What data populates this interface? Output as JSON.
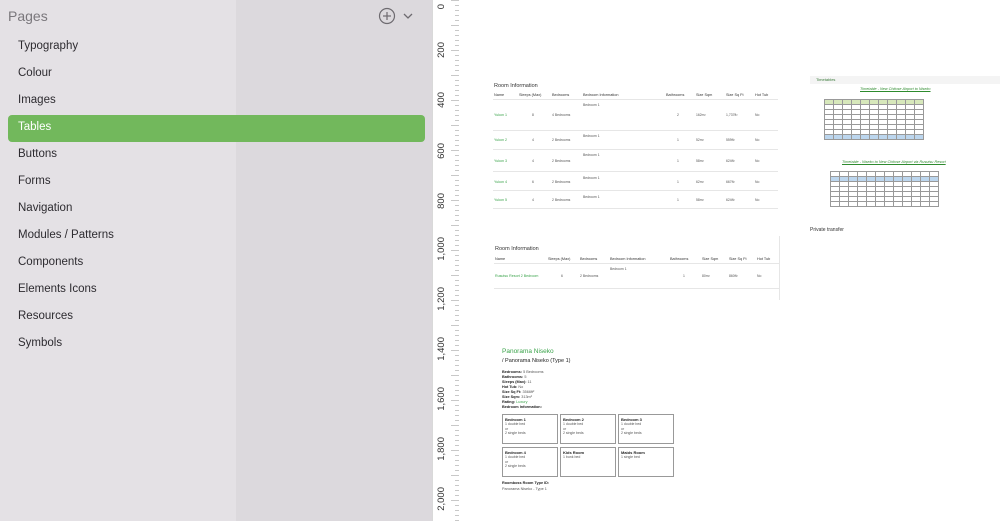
{
  "sidebar": {
    "title": "Pages",
    "add_icon": "plus-circle-icon",
    "menu_icon": "chevron-down-icon",
    "items": [
      {
        "label": "Typography"
      },
      {
        "label": "Colour"
      },
      {
        "label": "Images"
      },
      {
        "label": "Tables",
        "active": true
      },
      {
        "label": "Buttons"
      },
      {
        "label": "Forms"
      },
      {
        "label": "Navigation"
      },
      {
        "label": "Modules / Patterns"
      },
      {
        "label": "Components"
      },
      {
        "label": "Elements Icons"
      },
      {
        "label": "Resources"
      },
      {
        "label": "Symbols"
      }
    ]
  },
  "ruler": {
    "labels": [
      "0",
      "200",
      "400",
      "600",
      "800",
      "1,000",
      "1,200",
      "1,400",
      "1,600",
      "1,800",
      "2,000"
    ]
  },
  "canvas": {
    "room_table_1": {
      "title": "Room Information",
      "headers": [
        "Name",
        "Sleeps (Max)",
        "Bedrooms",
        "Bedroom Information",
        "Bathrooms",
        "Size Sqm",
        "Size Sq Ft",
        "Hot Tub"
      ],
      "rows": [
        {
          "name": "Yukon 1",
          "sleeps": "8",
          "bedrooms": "4 Bedrooms",
          "info": "Bedroom 1",
          "baths": "2",
          "sqm": "162m²",
          "sqft": "1,737ft²",
          "hottub": "No"
        },
        {
          "name": "Yukon 2",
          "sleeps": "4",
          "bedrooms": "2 Bedrooms",
          "info": "Bedroom 1",
          "baths": "1",
          "sqm": "52m²",
          "sqft": "559ft²",
          "hottub": "No"
        },
        {
          "name": "Yukon 3",
          "sleeps": "4",
          "bedrooms": "2 Bedrooms",
          "info": "Bedroom 1",
          "baths": "1",
          "sqm": "58m²",
          "sqft": "624ft²",
          "hottub": "No"
        },
        {
          "name": "Yukon 4",
          "sleeps": "6",
          "bedrooms": "2 Bedrooms",
          "info": "Bedroom 1",
          "baths": "1",
          "sqm": "62m²",
          "sqft": "667ft²",
          "hottub": "No"
        },
        {
          "name": "Yukon 5",
          "sleeps": "4",
          "bedrooms": "2 Bedrooms",
          "info": "Bedroom 1",
          "baths": "1",
          "sqm": "58m²",
          "sqft": "624ft²",
          "hottub": "No"
        }
      ]
    },
    "room_table_2": {
      "title": "Room Information",
      "headers": [
        "Name",
        "Sleeps (Max)",
        "Bedrooms",
        "Bedroom Information",
        "Bathrooms",
        "Size Sqm",
        "Size Sq Ft",
        "Hot Tub"
      ],
      "row": {
        "name": "Rusutsu Resort 2 Bedroom",
        "sleeps": "6",
        "bedrooms": "2 Bedrooms",
        "info": "Bedroom 1",
        "baths": "1",
        "sqm": "80m²",
        "sqft": "860ft²",
        "hottub": "No"
      }
    },
    "timetable": {
      "tab": "Timetables",
      "title1": "Timetable - New Chitose Airport to Niseko",
      "title2": "Timetable - Niseko to New Chitose Airport via Rusutsu Resort",
      "private": "Private transfer"
    },
    "property": {
      "title": "Panorama Niseko",
      "subtitle": "/ Panorama Niseko (Type 1)",
      "bedrooms_label": "Bedrooms:",
      "bedrooms_value": "5 Bedrooms",
      "bathrooms_label": "Bathrooms:",
      "bathrooms_value": "5",
      "sleeps_label": "Sleeps (Max):",
      "sleeps_value": "11",
      "hottub_label": "Hot Tub:",
      "hottub_value": "No",
      "sqft_label": "Size Sq Ft:",
      "sqft_value": "3566ft²",
      "sqm_label": "Size Sqm:",
      "sqm_value": "313m²",
      "rating_label": "Rating:",
      "rating_value": "Luxury",
      "bedinfo_label": "Bedroom Information:",
      "beds": [
        {
          "title": "Bedroom 1",
          "l1": "1 double bed",
          "l2": "or",
          "l3": "2 single beds"
        },
        {
          "title": "Bedroom 2",
          "l1": "1 double bed",
          "l2": "or",
          "l3": "2 single beds"
        },
        {
          "title": "Bedroom 3",
          "l1": "1 double bed",
          "l2": "or",
          "l3": "2 single beds"
        },
        {
          "title": "Bedroom 4",
          "l1": "1 double bed",
          "l2": "or",
          "l3": "2 single beds"
        },
        {
          "title": "Kids Room",
          "l1": "1 bunk bed",
          "l2": "",
          "l3": ""
        },
        {
          "title": "Maids Room",
          "l1": "1 single bed",
          "l2": "",
          "l3": ""
        }
      ],
      "roomboss_label": "Roomboss Room Type ID:",
      "roomboss_value": "Panorama Niseko - Type 1"
    }
  },
  "colors": {
    "accent": "#72b85c",
    "link": "#3aa34a",
    "sidebar_bg": "#e4e1e5"
  }
}
